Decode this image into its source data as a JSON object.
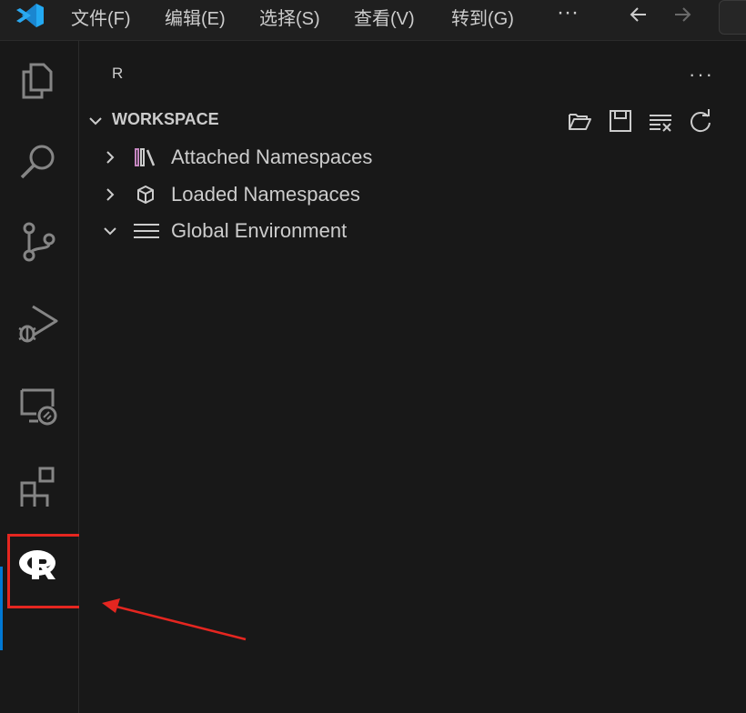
{
  "menu": {
    "items": [
      "文件(F)",
      "编辑(E)",
      "选择(S)",
      "查看(V)",
      "转到(G)"
    ],
    "more": "···"
  },
  "icons": {
    "app": "vscode-logo-icon",
    "back": "arrow-left-icon",
    "forward": "arrow-right-icon",
    "activity": [
      "explorer-icon",
      "search-icon",
      "source-control-icon",
      "run-debug-icon",
      "remote-explorer-icon",
      "extensions-icon",
      "r-logo-icon"
    ]
  },
  "colors": {
    "accent": "#0078d4",
    "highlight": "#e52620",
    "vscode_blue": "#23a9f2"
  },
  "sidebar": {
    "title": "R",
    "more": "···",
    "section": {
      "title": "WORKSPACE",
      "actions": [
        "open-folder-icon",
        "save-icon",
        "clear-all-icon",
        "refresh-icon"
      ]
    },
    "tree": [
      {
        "label": "Attached Namespaces",
        "icon": "library-icon",
        "expanded": false
      },
      {
        "label": "Loaded Namespaces",
        "icon": "package-icon",
        "expanded": false
      },
      {
        "label": "Global Environment",
        "icon": "list-icon",
        "expanded": true
      }
    ]
  }
}
